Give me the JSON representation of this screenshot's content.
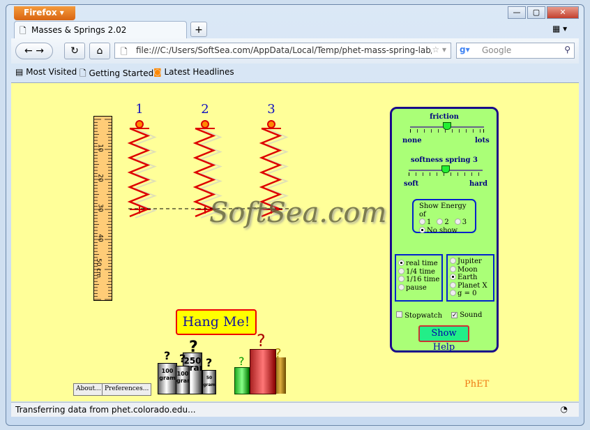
{
  "browser": {
    "menu_button": "Firefox",
    "tab_title": "Masses & Springs 2.02",
    "new_tab": "+",
    "url": "file:///C:/Users/SoftSea.com/AppData/Local/Temp/phet-mass-spring-lab/ma",
    "search_placeholder": "Google",
    "bookmarks": [
      "Most Visited",
      "Getting Started",
      "Latest Headlines"
    ],
    "status": "Transferring data from phet.colorado.edu..."
  },
  "sim": {
    "spring_labels": [
      "1",
      "2",
      "3"
    ],
    "ruler_labels": [
      "10",
      "20",
      "30",
      "40",
      "50 cm"
    ],
    "friction": {
      "label": "friction",
      "min": "none",
      "max": "lots",
      "value": 0.5
    },
    "softness": {
      "label": "softness spring 3",
      "min": "soft",
      "max": "hard",
      "value": 0.5
    },
    "energy": {
      "title": "Show Energy of",
      "options": [
        "1",
        "2",
        "3",
        "No show"
      ],
      "selected": "No show"
    },
    "time": {
      "options": [
        "real time",
        "1/4 time",
        "1/16 time",
        "pause"
      ],
      "selected": "real time"
    },
    "gravity": {
      "options": [
        "Jupiter",
        "Moon",
        "Earth",
        "Planet X",
        "g = 0"
      ],
      "selected": "Earth"
    },
    "stopwatch": {
      "label": "Stopwatch",
      "checked": false
    },
    "sound": {
      "label": "Sound",
      "checked": true
    },
    "show_help": "Show Help",
    "hang_me": "Hang Me!",
    "weights": [
      {
        "big": "100",
        "small": "gram"
      },
      {
        "big": "100",
        "small": "gram"
      },
      {
        "big": "250",
        "small": "gram"
      },
      {
        "big": "50",
        "small": "gram"
      }
    ],
    "about": "About...",
    "preferences": "Preferences...",
    "logo": "PhET",
    "watermark": "SoftSea.com"
  }
}
